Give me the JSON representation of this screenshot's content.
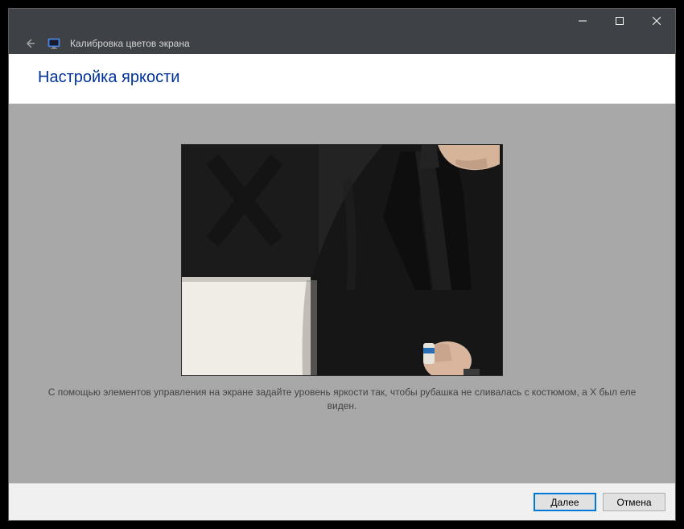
{
  "window": {
    "breadcrumb_title": "Калибровка цветов экрана"
  },
  "header": {
    "page_title": "Настройка яркости"
  },
  "content": {
    "instruction": "С помощью элементов управления на экране задайте уровень яркости так, чтобы рубашка не сливалась с костюмом, а X был еле виден."
  },
  "buttons": {
    "next": "Далее",
    "cancel": "Отмена"
  }
}
